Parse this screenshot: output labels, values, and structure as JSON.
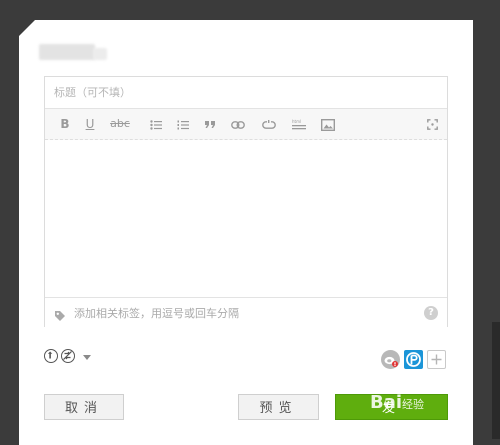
{
  "editor": {
    "title_placeholder": "标题（可不填）",
    "toolbar": {
      "bold": "B",
      "underline": "U",
      "strike": "abc"
    },
    "tag_placeholder": "添加相关标签，用逗号或回车分隔",
    "help": "?"
  },
  "buttons": {
    "cancel": "取消",
    "preview": "预览",
    "publish": "发"
  },
  "watermark": {
    "brand": "Bai",
    "suffix": "经验"
  },
  "colors": {
    "overlay": "#3b3b3b",
    "primary": "#5fae0e",
    "toolbar_icon": "#9a9a9a"
  },
  "icons": [
    "bold-icon",
    "underline-icon",
    "strikethrough-icon",
    "bullet-list-icon",
    "numbered-list-icon",
    "quote-icon",
    "link-icon",
    "unlink-icon",
    "html-icon",
    "image-icon",
    "fullscreen-icon",
    "tag-icon",
    "help-icon",
    "visibility-icon",
    "no-repost-icon",
    "weibo-icon",
    "qzone-icon",
    "add-share-icon"
  ]
}
